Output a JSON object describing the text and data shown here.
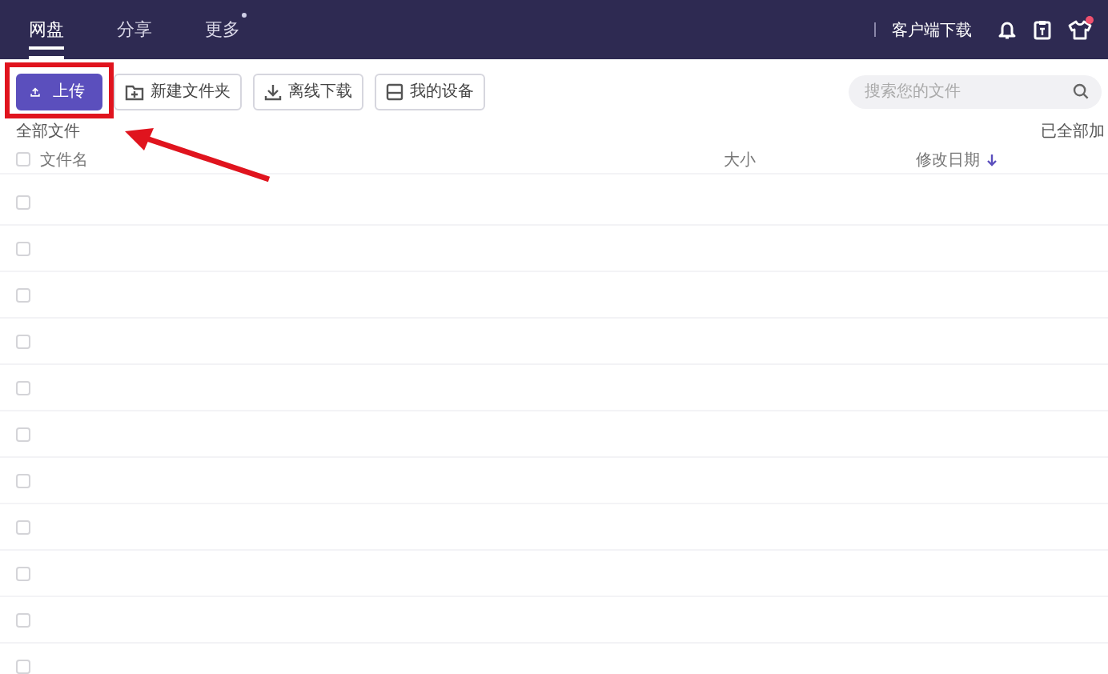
{
  "top_nav": {
    "tabs": [
      {
        "label": "网盘",
        "selected": true,
        "badge": false
      },
      {
        "label": "分享",
        "selected": false,
        "badge": false
      },
      {
        "label": "更多",
        "selected": false,
        "badge": true
      }
    ],
    "download_link": "客户端下载",
    "skin_badge": true
  },
  "toolbar": {
    "buttons": [
      {
        "label": "上传",
        "kind": "upload"
      },
      {
        "label": "新建文件夹",
        "kind": "folder"
      },
      {
        "label": "离线下载",
        "kind": "download"
      },
      {
        "label": "我的设备",
        "kind": "device"
      }
    ],
    "search": {
      "placeholder": "搜索您的文件"
    }
  },
  "breadcrumb": "全部文件",
  "load_status": "已全部加",
  "table": {
    "header_checked": false,
    "columns": [
      {
        "label": "文件名"
      },
      {
        "label": "大小"
      },
      {
        "label": "修改日期",
        "sorted_desc": true
      }
    ],
    "rows": [
      {
        "checked": false
      },
      {
        "checked": false
      },
      {
        "checked": false
      },
      {
        "checked": false
      },
      {
        "checked": false
      },
      {
        "checked": false
      },
      {
        "checked": false
      },
      {
        "checked": false
      },
      {
        "checked": false
      },
      {
        "checked": false
      },
      {
        "checked": false
      }
    ]
  }
}
